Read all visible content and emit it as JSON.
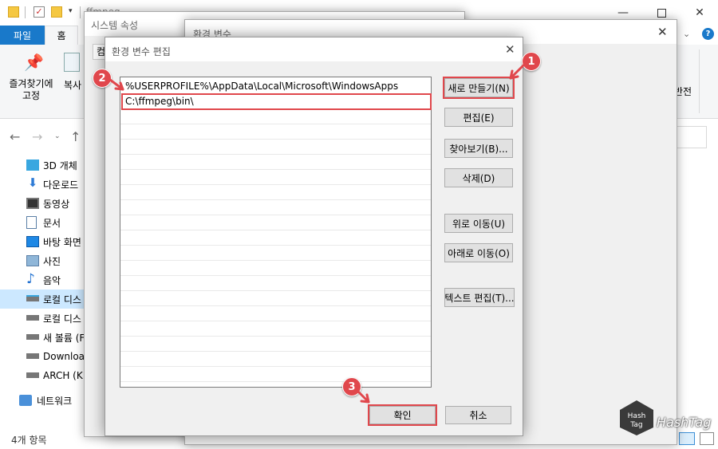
{
  "explorer": {
    "title": "ffmpeg",
    "tabs": {
      "file": "파일",
      "home": "홈"
    },
    "ribbon": {
      "pin_label_1": "즐겨찾기에",
      "pin_label_2": "고정",
      "copy_label": "복사",
      "right_label": "반전"
    },
    "sidebar": [
      {
        "label": "3D 개체",
        "icon": "cube-icon"
      },
      {
        "label": "다운로드",
        "icon": "download-icon"
      },
      {
        "label": "동영상",
        "icon": "video-icon"
      },
      {
        "label": "문서",
        "icon": "document-icon"
      },
      {
        "label": "바탕 화면",
        "icon": "desktop-icon"
      },
      {
        "label": "사진",
        "icon": "picture-icon"
      },
      {
        "label": "음악",
        "icon": "music-icon"
      },
      {
        "label": "로컬 디스",
        "icon": "drive-icon"
      },
      {
        "label": "로컬 디스",
        "icon": "drive-icon"
      },
      {
        "label": "새 볼륨 (F",
        "icon": "drive-icon"
      },
      {
        "label": "Downloa",
        "icon": "drive-icon"
      },
      {
        "label": "ARCH (K:",
        "icon": "drive-icon"
      }
    ],
    "network": "네트워크",
    "status": "4개 항목"
  },
  "system_props": {
    "title": "시스템 속성",
    "tab_partial": "컴"
  },
  "env_vars": {
    "title": "환경 변수"
  },
  "editor": {
    "title": "환경 변수 편집",
    "entries": [
      "%USERPROFILE%\\AppData\\Local\\Microsoft\\WindowsApps",
      "C:\\ffmpeg\\bin\\"
    ],
    "buttons": {
      "new": "새로 만들기(N)",
      "edit": "편집(E)",
      "browse": "찾아보기(B)...",
      "delete": "삭제(D)",
      "move_up": "위로 이동(U)",
      "move_down": "아래로 이동(O)",
      "edit_text": "텍스트 편집(T)...",
      "ok": "확인",
      "cancel": "취소"
    },
    "badges": [
      "1",
      "2",
      "3"
    ]
  },
  "watermark": {
    "line1": "Hash",
    "line2": "Tag",
    "text": "HashTag"
  },
  "colors": {
    "accent": "#1979ca",
    "highlight": "#e0474c"
  }
}
